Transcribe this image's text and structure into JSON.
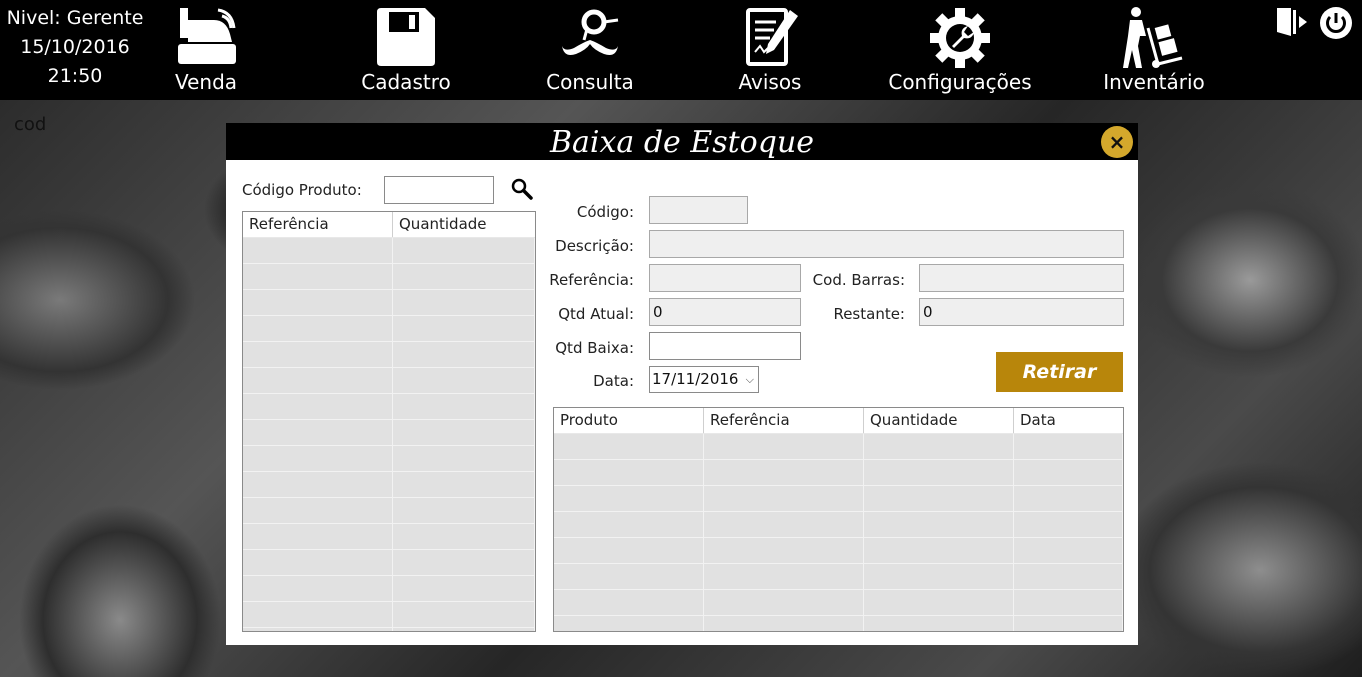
{
  "status": {
    "level": "Nivel: Gerente",
    "date": "15/10/2016",
    "time": "21:50"
  },
  "nav": {
    "venda": "Venda",
    "cadastro": "Cadastro",
    "consulta": "Consulta",
    "avisos": "Avisos",
    "configuracoes": "Configurações",
    "inventario": "Inventário"
  },
  "background_label": "cod",
  "dialog": {
    "title": "Baixa de Estoque",
    "close_icon": "×",
    "search": {
      "label": "Código Produto:",
      "value": ""
    },
    "left_table": {
      "columns": [
        "Referência",
        "Quantidade"
      ],
      "rows": []
    },
    "form": {
      "codigo_label": "Código:",
      "codigo_value": "",
      "descricao_label": "Descrição:",
      "descricao_value": "",
      "referencia_label": "Referência:",
      "referencia_value": "",
      "codbarras_label": "Cod. Barras:",
      "codbarras_value": "",
      "qtdatual_label": "Qtd Atual:",
      "qtdatual_value": "0",
      "restante_label": "Restante:",
      "restante_value": "0",
      "qtdbaixa_label": "Qtd Baixa:",
      "qtdbaixa_value": "",
      "data_label": "Data:",
      "data_value": "17/11/2016"
    },
    "retirar_label": "Retirar",
    "right_table": {
      "columns": [
        "Produto",
        "Referência",
        "Quantidade",
        "Data"
      ],
      "rows": []
    }
  },
  "colors": {
    "accent": "#b8860b",
    "close": "#d4a82c",
    "topbar": "#000000"
  }
}
